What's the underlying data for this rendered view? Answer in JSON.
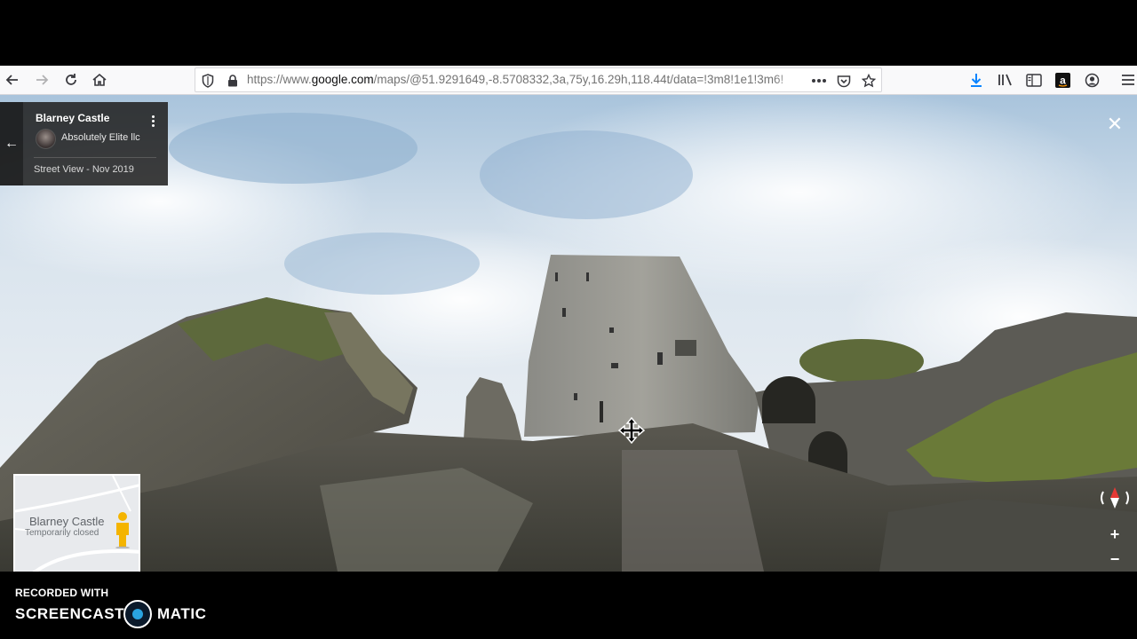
{
  "browser": {
    "url_prefix": "https://www.",
    "url_host": "google.com",
    "url_path": "/maps/@51.9291649,-8.5708332,3a,75y,16.29h,118.44t/data=!3m8!1e1!3m6!",
    "icons": [
      "back-arrow",
      "forward-arrow",
      "reload",
      "home",
      "shield",
      "padlock",
      "more-horizontal",
      "pocket",
      "star",
      "download",
      "library",
      "sidebar",
      "amazon",
      "account",
      "menu"
    ]
  },
  "streetview": {
    "place_title": "Blarney Castle",
    "author": "Absolutely Elite llc",
    "date_label": "Street View - Nov 2019",
    "close_symbol": "✕",
    "back_symbol": "←"
  },
  "minimap": {
    "title": "Blarney Castle",
    "subtitle": "Temporarily closed"
  },
  "controls": {
    "zoom_in": "+",
    "zoom_out": "−"
  },
  "watermark": {
    "recorded_with": "RECORDED WITH",
    "brand_left": "SCREENCAST",
    "brand_right": "MATIC"
  },
  "colors": {
    "download_accent": "#0a84ff",
    "compass_red": "#e53935",
    "screencast_blue": "#2aa4e0"
  }
}
